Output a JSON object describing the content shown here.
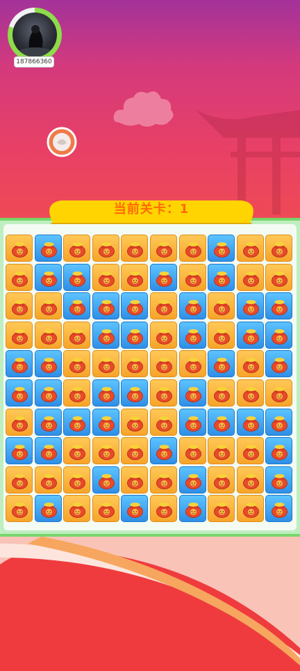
{
  "player": {
    "id": "187866360",
    "progress_fraction": 0.8
  },
  "level": {
    "label": "当前关卡：1"
  },
  "colors": {
    "orange_tile": "#f7a42a",
    "blue_tile": "#2f8fe6",
    "board_border": "#78d66b",
    "title_text": "#ff6a00",
    "banner": "#ffd400"
  },
  "board": {
    "icon": "money-bag-icon",
    "rows": [
      [
        "o",
        "b",
        "o",
        "o",
        "o",
        "o",
        "o",
        "b",
        "o",
        "o"
      ],
      [
        "o",
        "b",
        "b",
        "o",
        "o",
        "b",
        "o",
        "b",
        "o",
        "o"
      ],
      [
        "o",
        "o",
        "b",
        "b",
        "b",
        "o",
        "b",
        "o",
        "b",
        "b"
      ],
      [
        "o",
        "o",
        "o",
        "b",
        "b",
        "o",
        "b",
        "o",
        "b",
        "b"
      ],
      [
        "b",
        "b",
        "o",
        "o",
        "o",
        "o",
        "o",
        "b",
        "o",
        "b"
      ],
      [
        "b",
        "b",
        "o",
        "b",
        "b",
        "o",
        "b",
        "o",
        "o",
        "o"
      ],
      [
        "o",
        "b",
        "b",
        "b",
        "o",
        "o",
        "b",
        "b",
        "b",
        "b"
      ],
      [
        "b",
        "b",
        "o",
        "o",
        "o",
        "b",
        "o",
        "o",
        "o",
        "b"
      ],
      [
        "o",
        "o",
        "o",
        "b",
        "o",
        "o",
        "b",
        "o",
        "o",
        "b"
      ],
      [
        "o",
        "b",
        "o",
        "o",
        "b",
        "o",
        "b",
        "o",
        "o",
        "b"
      ]
    ]
  }
}
